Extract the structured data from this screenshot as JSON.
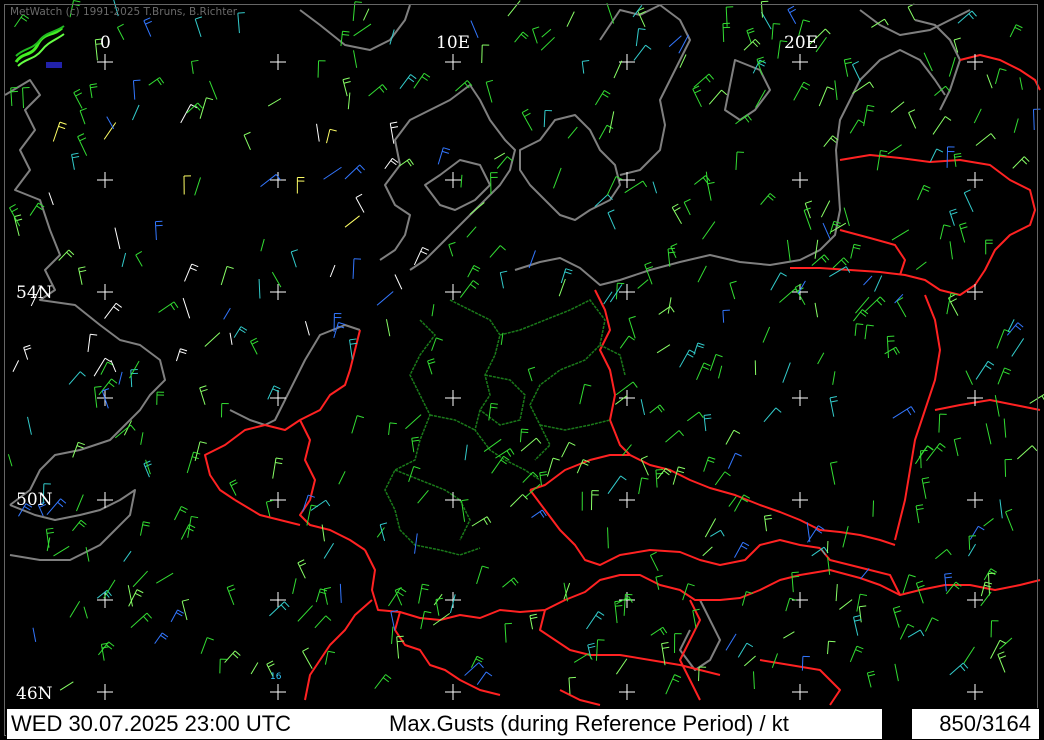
{
  "app": {
    "copyright": "MetWatch  (c) 1991-2025 T.Bruns, B.Richter"
  },
  "map": {
    "longitude_labels": [
      "0",
      "10E",
      "20E"
    ],
    "latitude_labels": [
      "54N",
      "50N",
      "46N"
    ],
    "station_marker_label": "16",
    "colors": {
      "background": "#000000",
      "coast": "#7f7f7f",
      "borders": "#ff2222",
      "states": "#1a7a1a",
      "grid": "#ffffff",
      "barb_green": "#33dd33",
      "barb_lightgreen": "#88ff66",
      "barb_blue": "#3377ff",
      "barb_cyan": "#33cccc",
      "barb_white": "#ffffff",
      "barb_yellow": "#ffff66"
    },
    "icons": [
      "metwatch-logo-icon",
      "grid-cross-icon",
      "wind-barb-icon"
    ]
  },
  "footer": {
    "datetime": "WED 30.07.2025 23:00 UTC",
    "parameter": "Max.Gusts (during Reference Period) / kt",
    "count": "850/3164"
  }
}
